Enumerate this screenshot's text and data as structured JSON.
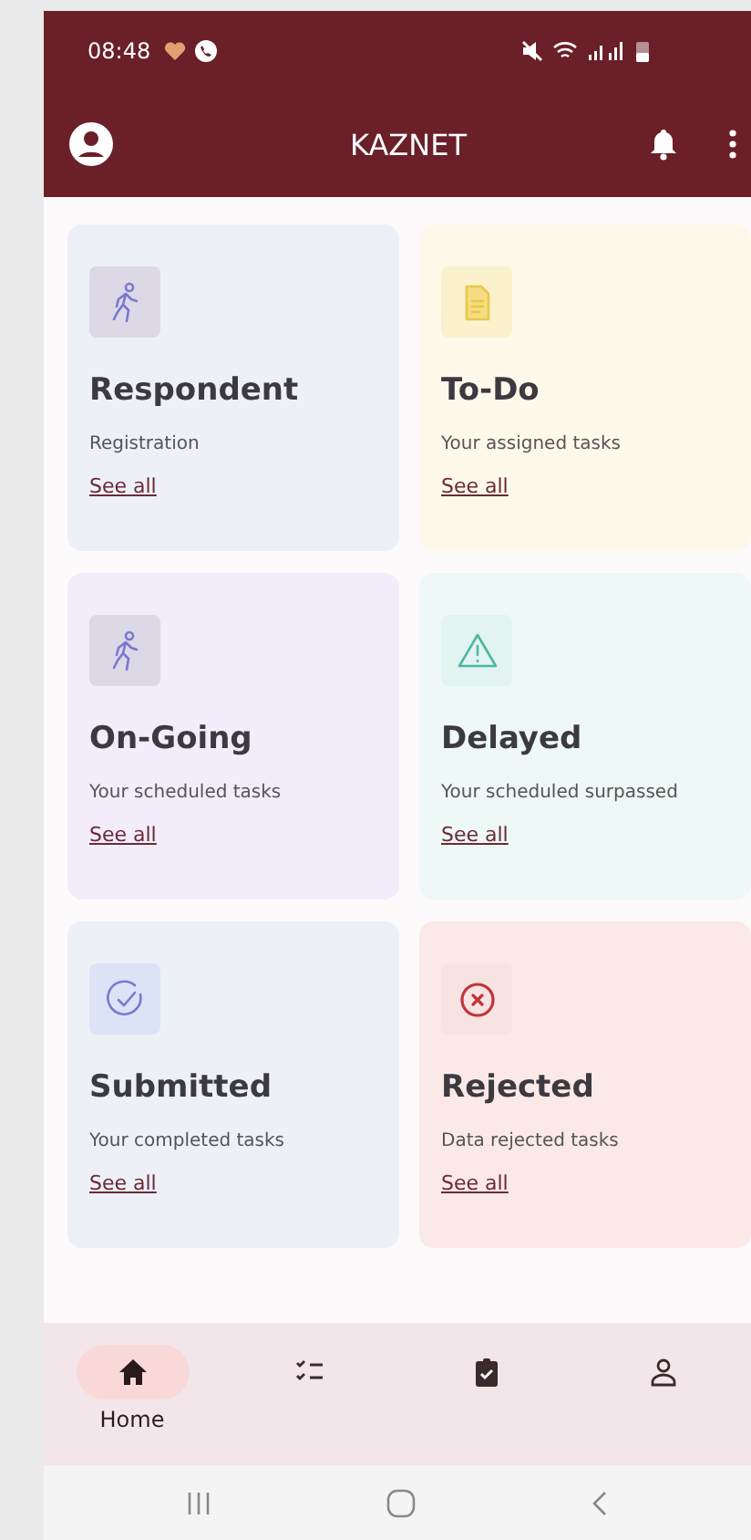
{
  "status_bar": {
    "time": "08:48"
  },
  "app_bar": {
    "title": "KAZNET"
  },
  "cards": [
    {
      "kind": "walk",
      "title": "Respondent",
      "subtitle": "Registration",
      "link": "See all",
      "color": "#eef0f8"
    },
    {
      "kind": "document",
      "title": "To-Do",
      "subtitle": "Your assigned tasks",
      "link": "See all",
      "color": "#fdf9ea"
    },
    {
      "kind": "walk",
      "title": "On-Going",
      "subtitle": "Your scheduled tasks",
      "link": "See all",
      "color": "#f2ecfb"
    },
    {
      "kind": "warning",
      "title": "Delayed",
      "subtitle": "Your scheduled surpassed",
      "link": "See all",
      "color": "#eef8f6"
    },
    {
      "kind": "check",
      "title": "Submitted",
      "subtitle": "Your completed tasks",
      "link": "See all",
      "color": "#eef0f8"
    },
    {
      "kind": "reject",
      "title": "Rejected",
      "subtitle": "Data rejected tasks",
      "link": "See all",
      "color": "#fbe9e7"
    }
  ],
  "bottom_nav": [
    {
      "kind": "home",
      "label": "Home",
      "selected": true
    },
    {
      "kind": "checklist",
      "selected": false
    },
    {
      "kind": "clipboard",
      "selected": false
    },
    {
      "kind": "person",
      "selected": false
    }
  ]
}
